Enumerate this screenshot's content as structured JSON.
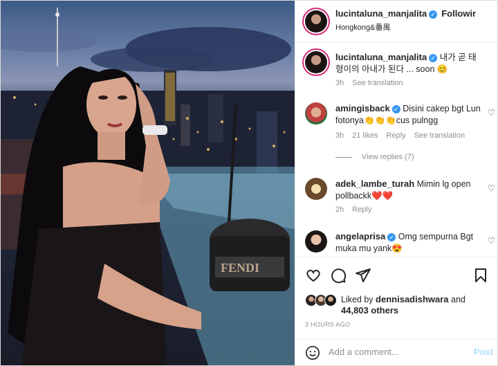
{
  "post": {
    "author": "lucintaluna_manjalita",
    "follow_label": "Followir",
    "location": "Hongkong&番禺"
  },
  "caption": {
    "author": "lucintaluna_manjalita",
    "text": "내가 곧 태형이의 아내가 된다 ... soon 😊",
    "age": "3h",
    "see_translation": "See translation"
  },
  "comments": [
    {
      "author": "amingisback",
      "verified": true,
      "text": "Disini cakep bgt Lun fotonya👏👏👏cus pulngg",
      "age": "3h",
      "likes": "21 likes",
      "reply": "Reply",
      "see_translation": "See translation",
      "view_replies": "View replies (7)"
    },
    {
      "author": "adek_lambe_turah",
      "verified": false,
      "text": "Mimin lg open pollbackk❤️❤️",
      "age": "2h",
      "reply": "Reply"
    },
    {
      "author": "angelaprisa",
      "verified": true,
      "text": "Omg sempurna Bgt muka mu yank😍"
    }
  ],
  "likes": {
    "liked_by_prefix": "Liked by",
    "liked_by_user": "dennisadishwara",
    "and": "and",
    "others": "44,803 others"
  },
  "timestamp": "3 HOURS AGO",
  "add_comment": {
    "placeholder": "Add a comment...",
    "post_label": "Post"
  },
  "icons": [
    "heart-icon",
    "comment-icon",
    "share-icon",
    "bookmark-icon",
    "emoji-icon",
    "verified-icon"
  ],
  "colors": {
    "verified": "#3897f0",
    "story_ring": "#d62976",
    "post_disabled": "#b2dffc",
    "meta": "#8e8e8e"
  }
}
